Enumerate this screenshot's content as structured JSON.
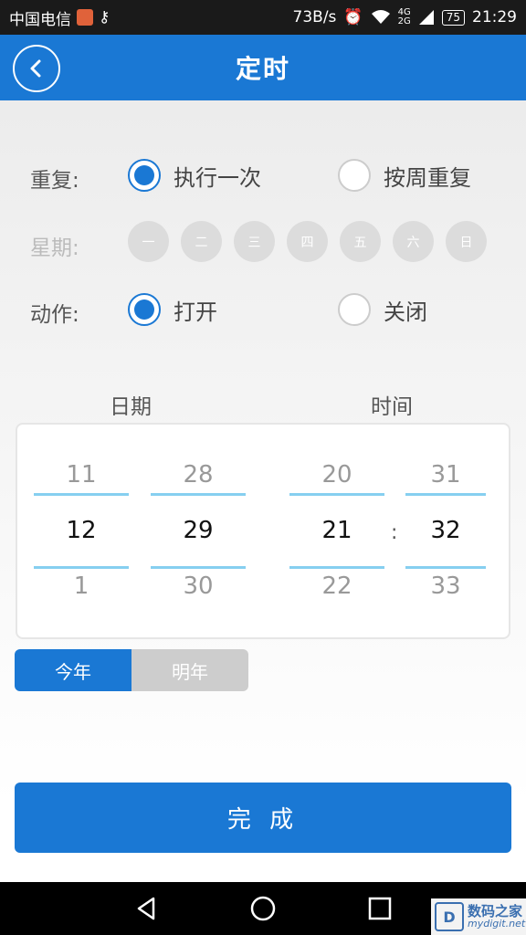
{
  "status_bar": {
    "carrier": "中国电信",
    "speed": "73B/s",
    "signal": "4G\n2G",
    "battery": "75",
    "time": "21:29"
  },
  "header": {
    "title": "定时"
  },
  "form": {
    "repeat_label": "重复:",
    "repeat_options": [
      "执行一次",
      "按周重复"
    ],
    "repeat_selected": "执行一次",
    "weekday_label": "星期:",
    "weekdays": [
      "一",
      "二",
      "三",
      "四",
      "五",
      "六",
      "日"
    ],
    "action_label": "动作:",
    "action_options": [
      "打开",
      "关闭"
    ],
    "action_selected": "打开"
  },
  "picker": {
    "date_title": "日期",
    "time_title": "时间",
    "month": {
      "prev": "11",
      "current": "12",
      "next": "1"
    },
    "day": {
      "prev": "28",
      "current": "29",
      "next": "30"
    },
    "hour": {
      "prev": "20",
      "current": "21",
      "next": "22"
    },
    "minute": {
      "prev": "31",
      "current": "32",
      "next": "33"
    },
    "separator": ":"
  },
  "year_toggle": {
    "options": [
      "今年",
      "明年"
    ],
    "selected": "今年"
  },
  "done_button": "完 成",
  "watermark": {
    "title": "数码之家",
    "url": "mydigit.net"
  },
  "colors": {
    "accent": "#1a78d4",
    "wheel_line": "#86cff0",
    "disabled": "#dcdcdc"
  }
}
